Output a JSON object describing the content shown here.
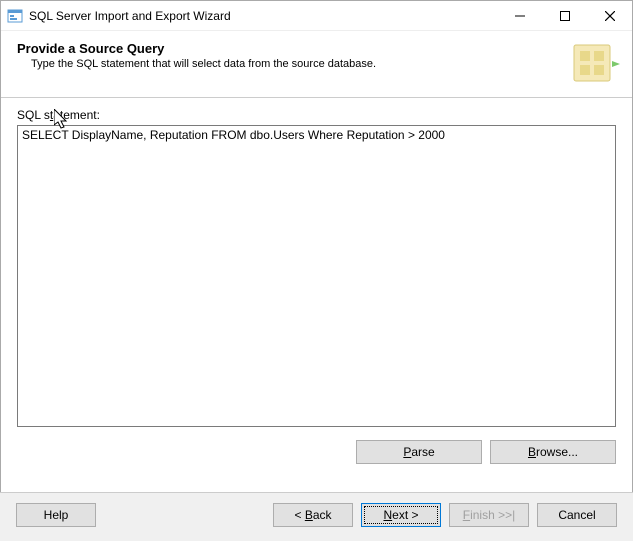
{
  "window": {
    "title": "SQL Server Import and Export Wizard"
  },
  "header": {
    "title": "Provide a Source Query",
    "subtitle": "Type the SQL statement that will select data from the source database."
  },
  "content": {
    "field_label": "SQL statement:",
    "query_value": "SELECT DisplayName, Reputation FROM dbo.Users Where Reputation > 2000",
    "parse_label": "Parse",
    "browse_label": "Browse..."
  },
  "footer": {
    "help_label": "Help",
    "back_label": "< Back",
    "next_label": "Next >",
    "finish_label": "Finish >>|",
    "cancel_label": "Cancel"
  }
}
